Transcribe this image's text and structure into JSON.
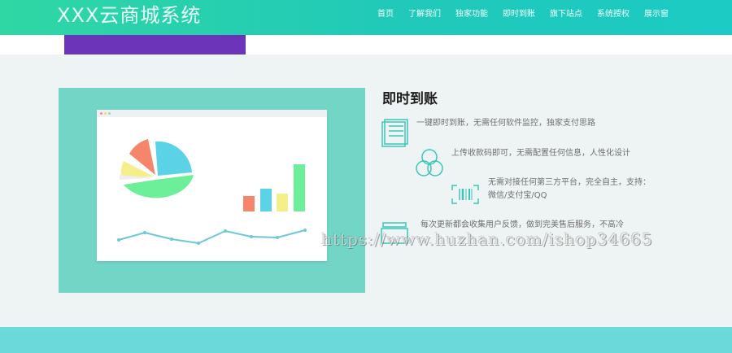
{
  "header": {
    "logo": "XXX云商城系统",
    "nav": [
      "首页",
      "了解我们",
      "独家功能",
      "即时到账",
      "旗下站点",
      "系统授权",
      "展示窗"
    ]
  },
  "feature": {
    "title": "即时到账",
    "items": [
      {
        "icon": "document-icon",
        "text": "一键即时到账，无需任何软件监控，独家支付思路"
      },
      {
        "icon": "circles-icon",
        "text": "上传收款码即可，无需配置任何信息，人性化设计"
      },
      {
        "icon": "barcode-icon",
        "line1": "无需对接任何第三方平台，完全自主，支持：",
        "line2": "微信/支付宝/QQ"
      },
      {
        "icon": "stack-icon",
        "text": "每次更新都会收集用户反馈，做到完美售后服务，不高冷"
      }
    ]
  },
  "illustration": {
    "pie_colors": [
      "#5cd2e6",
      "#6cef98",
      "#f4ef8a",
      "#f6866a",
      "#f2f2f2"
    ],
    "bar_colors": [
      "#f6866a",
      "#5cd2e6",
      "#f4ef8a",
      "#6cef98"
    ],
    "line_color": "#6cc7d8"
  },
  "watermark": "https://www.huzhan.com/ishop34665",
  "colors": {
    "header_start": "#2fd7a4",
    "header_end": "#1ccbc4",
    "purple": "#6c35b9",
    "teal_panel": "#72d5c6",
    "icon_teal": "#3cc6b8"
  }
}
